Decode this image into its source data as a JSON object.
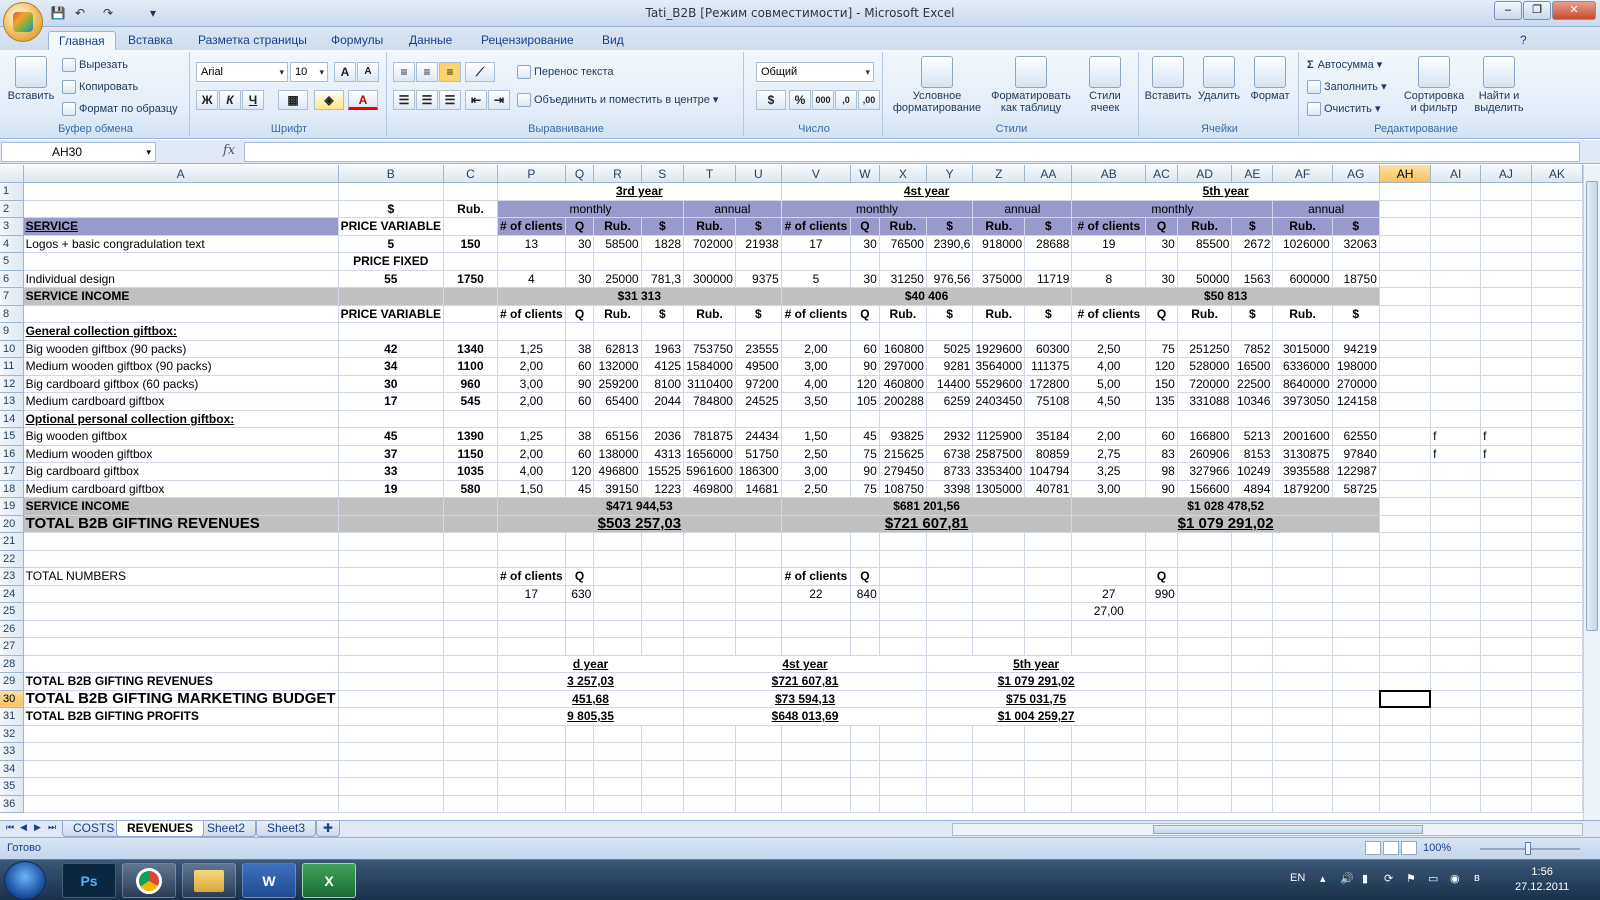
{
  "window": {
    "title": "Tati_B2B  [Режим совместимости] - Microsoft Excel"
  },
  "qat": {
    "save": "💾",
    "undo": "↶",
    "redo": "↷",
    "customize": "▾"
  },
  "ribbon_tabs": [
    "Главная",
    "Вставка",
    "Разметка страницы",
    "Формулы",
    "Данные",
    "Рецензирование",
    "Вид"
  ],
  "ribbon": {
    "clipboard": {
      "label": "Буфер обмена",
      "paste": "Вставить",
      "cut": "Вырезать",
      "copy": "Копировать",
      "format_painter": "Формат по образцу"
    },
    "font": {
      "label": "Шрифт",
      "name": "Arial",
      "size": "10",
      "grow": "A",
      "shrink": "A",
      "bold": "Ж",
      "italic": "К",
      "underline": "Ч",
      "color_letter": "A"
    },
    "alignment": {
      "label": "Выравнивание",
      "wrap": "Перенос текста",
      "merge": "Объединить и поместить в центре"
    },
    "number": {
      "label": "Число",
      "format": "Общий",
      "percent": "%",
      "thousands": "000",
      "inc_dec": ",0",
      "dec_dec": ",00"
    },
    "styles": {
      "label": "Стили",
      "conditional": "Условное форматирование",
      "as_table": "Форматировать как таблицу",
      "cell_styles": "Стили ячеек"
    },
    "cells": {
      "label": "Ячейки",
      "insert": "Вставить",
      "delete": "Удалить",
      "format": "Формат"
    },
    "editing": {
      "label": "Редактирование",
      "autosum": "Автосумма",
      "fill": "Заполнить",
      "clear": "Очистить",
      "sort": "Сортировка и фильтр",
      "find": "Найти и выделить"
    }
  },
  "formula_bar": {
    "name_box": "AH30",
    "fx": "fx",
    "value": ""
  },
  "columns": [
    "A",
    "B",
    "C",
    "P",
    "Q",
    "R",
    "S",
    "T",
    "U",
    "V",
    "W",
    "X",
    "Y",
    "Z",
    "AA",
    "AB",
    "AC",
    "AD",
    "AE",
    "AF",
    "AG",
    "AH",
    "AI",
    "AJ",
    "AK"
  ],
  "selected": {
    "row": "30",
    "col": "AH"
  },
  "rows": [
    {
      "n": "1",
      "cells": {}
    },
    {
      "n": "2",
      "cells": {}
    },
    {
      "n": "3",
      "cells": {
        "A": "SERVICE",
        "B": "PRICE VARIABLE",
        "P": "# of clients",
        "Q": "Q",
        "R": "Rub.",
        "S": "$",
        "T": "Rub.",
        "U": "$",
        "V": "# of clients",
        "W": "Q",
        "X": "Rub.",
        "Y": "$",
        "Z": "Rub.",
        "AA": "$",
        "AB": "# of clients",
        "AC": "Q",
        "AD": "Rub.",
        "AE": "$",
        "AF": "Rub.",
        "AG": "$"
      }
    },
    {
      "n": "4",
      "cells": {
        "A": "Logos + basic congradulation text",
        "B": "5",
        "C": "150",
        "P": "13",
        "Q": "30",
        "R": "58500",
        "S": "1828",
        "T": "702000",
        "U": "21938",
        "V": "17",
        "W": "30",
        "X": "76500",
        "Y": "2390,6",
        "Z": "918000",
        "AA": "28688",
        "AB": "19",
        "AC": "30",
        "AD": "85500",
        "AE": "2672",
        "AF": "1026000",
        "AG": "32063"
      }
    },
    {
      "n": "5",
      "cells": {
        "B": "PRICE FIXED"
      }
    },
    {
      "n": "6",
      "cells": {
        "A": "Individual design",
        "B": "55",
        "C": "1750",
        "P": "4",
        "Q": "30",
        "R": "25000",
        "S": "781,3",
        "T": "300000",
        "U": "9375",
        "V": "5",
        "W": "30",
        "X": "31250",
        "Y": "976,56",
        "Z": "375000",
        "AA": "11719",
        "AB": "8",
        "AC": "30",
        "AD": "50000",
        "AE": "1563",
        "AF": "600000",
        "AG": "18750"
      }
    },
    {
      "n": "7",
      "cells": {
        "A": "SERVICE INCOME"
      }
    },
    {
      "n": "8",
      "cells": {
        "B": "PRICE VARIABLE",
        "P": "# of clients",
        "Q": "Q",
        "R": "Rub.",
        "S": "$",
        "T": "Rub.",
        "U": "$",
        "V": "# of clients",
        "W": "Q",
        "X": "Rub.",
        "Y": "$",
        "Z": "Rub.",
        "AA": "$",
        "AB": "# of clients",
        "AC": "Q",
        "AD": "Rub.",
        "AE": "$",
        "AF": "Rub.",
        "AG": "$"
      }
    },
    {
      "n": "9",
      "cells": {
        "A": "General collection giftbox:"
      }
    },
    {
      "n": "10",
      "cells": {
        "A": "Big wooden giftbox (90 packs)",
        "B": "42",
        "C": "1340",
        "P": "1,25",
        "Q": "38",
        "R": "62813",
        "S": "1963",
        "T": "753750",
        "U": "23555",
        "V": "2,00",
        "W": "60",
        "X": "160800",
        "Y": "5025",
        "Z": "1929600",
        "AA": "60300",
        "AB": "2,50",
        "AC": "75",
        "AD": "251250",
        "AE": "7852",
        "AF": "3015000",
        "AG": "94219"
      }
    },
    {
      "n": "11",
      "cells": {
        "A": "Medium wooden giftbox (90 packs)",
        "B": "34",
        "C": "1100",
        "P": "2,00",
        "Q": "60",
        "R": "132000",
        "S": "4125",
        "T": "1584000",
        "U": "49500",
        "V": "3,00",
        "W": "90",
        "X": "297000",
        "Y": "9281",
        "Z": "3564000",
        "AA": "111375",
        "AB": "4,00",
        "AC": "120",
        "AD": "528000",
        "AE": "16500",
        "AF": "6336000",
        "AG": "198000"
      }
    },
    {
      "n": "12",
      "cells": {
        "A": "Big cardboard giftbox (60 packs)",
        "B": "30",
        "C": "960",
        "P": "3,00",
        "Q": "90",
        "R": "259200",
        "S": "8100",
        "T": "3110400",
        "U": "97200",
        "V": "4,00",
        "W": "120",
        "X": "460800",
        "Y": "14400",
        "Z": "5529600",
        "AA": "172800",
        "AB": "5,00",
        "AC": "150",
        "AD": "720000",
        "AE": "22500",
        "AF": "8640000",
        "AG": "270000"
      }
    },
    {
      "n": "13",
      "cells": {
        "A": "Medium cardboard giftbox",
        "B": "17",
        "C": "545",
        "P": "2,00",
        "Q": "60",
        "R": "65400",
        "S": "2044",
        "T": "784800",
        "U": "24525",
        "V": "3,50",
        "W": "105",
        "X": "200288",
        "Y": "6259",
        "Z": "2403450",
        "AA": "75108",
        "AB": "4,50",
        "AC": "135",
        "AD": "331088",
        "AE": "10346",
        "AF": "3973050",
        "AG": "124158"
      }
    },
    {
      "n": "14",
      "cells": {
        "A": "Optional personal collection giftbox:"
      }
    },
    {
      "n": "15",
      "cells": {
        "A": "Big wooden giftbox",
        "B": "45",
        "C": "1390",
        "P": "1,25",
        "Q": "38",
        "R": "65156",
        "S": "2036",
        "T": "781875",
        "U": "24434",
        "V": "1,50",
        "W": "45",
        "X": "93825",
        "Y": "2932",
        "Z": "1125900",
        "AA": "35184",
        "AB": "2,00",
        "AC": "60",
        "AD": "166800",
        "AE": "5213",
        "AF": "2001600",
        "AG": "62550",
        "AI": "f",
        "AJ": "f"
      }
    },
    {
      "n": "16",
      "cells": {
        "A": "Medium wooden giftbox",
        "B": "37",
        "C": "1150",
        "P": "2,00",
        "Q": "60",
        "R": "138000",
        "S": "4313",
        "T": "1656000",
        "U": "51750",
        "V": "2,50",
        "W": "75",
        "X": "215625",
        "Y": "6738",
        "Z": "2587500",
        "AA": "80859",
        "AB": "2,75",
        "AC": "83",
        "AD": "260906",
        "AE": "8153",
        "AF": "3130875",
        "AG": "97840",
        "AI": "f",
        "AJ": "f"
      }
    },
    {
      "n": "17",
      "cells": {
        "A": "Big cardboard giftbox",
        "B": "33",
        "C": "1035",
        "P": "4,00",
        "Q": "120",
        "R": "496800",
        "S": "15525",
        "T": "5961600",
        "U": "186300",
        "V": "3,00",
        "W": "90",
        "X": "279450",
        "Y": "8733",
        "Z": "3353400",
        "AA": "104794",
        "AB": "3,25",
        "AC": "98",
        "AD": "327966",
        "AE": "10249",
        "AF": "3935588",
        "AG": "122987"
      }
    },
    {
      "n": "18",
      "cells": {
        "A": "Medium cardboard giftbox",
        "B": "19",
        "C": "580",
        "P": "1,50",
        "Q": "45",
        "R": "39150",
        "S": "1223",
        "T": "469800",
        "U": "14681",
        "V": "2,50",
        "W": "75",
        "X": "108750",
        "Y": "3398",
        "Z": "1305000",
        "AA": "40781",
        "AB": "3,00",
        "AC": "90",
        "AD": "156600",
        "AE": "4894",
        "AF": "1879200",
        "AG": "58725"
      }
    },
    {
      "n": "19",
      "cells": {
        "A": "SERVICE INCOME"
      }
    },
    {
      "n": "20",
      "cells": {
        "A": "TOTAL B2B GIFTING REVENUES"
      }
    },
    {
      "n": "21",
      "cells": {}
    },
    {
      "n": "22",
      "cells": {}
    },
    {
      "n": "23",
      "cells": {
        "A": "TOTAL NUMBERS",
        "P": "# of clients",
        "Q": "Q",
        "V": "# of clients",
        "W": "Q",
        "AC": "Q"
      }
    },
    {
      "n": "24",
      "cells": {
        "P": "17",
        "Q": "630",
        "V": "22",
        "W": "840",
        "AB": "27",
        "AC": "990"
      }
    },
    {
      "n": "25",
      "cells": {
        "AB": "27,00"
      }
    },
    {
      "n": "26",
      "cells": {}
    },
    {
      "n": "27",
      "cells": {}
    },
    {
      "n": "28",
      "cells": {}
    },
    {
      "n": "29",
      "cells": {
        "A": "TOTAL B2B GIFTING REVENUES"
      }
    },
    {
      "n": "30",
      "cells": {
        "A": "TOTAL B2B GIFTING MARKETING BUDGET"
      }
    },
    {
      "n": "31",
      "cells": {
        "A": "TOTAL B2B GIFTING PROFITS"
      }
    },
    {
      "n": "32",
      "cells": {}
    },
    {
      "n": "33",
      "cells": {}
    },
    {
      "n": "34",
      "cells": {}
    },
    {
      "n": "35",
      "cells": {}
    },
    {
      "n": "36",
      "cells": {}
    }
  ],
  "merged": {
    "r1_y3": "3rd year",
    "r1_y4": "4st year",
    "r1_y5": "5th year",
    "r2_usd": "$",
    "r2_rub": "Rub.",
    "monthly": "monthly",
    "annual": "annual",
    "r7_y3": "$31 313",
    "r7_y4": "$40 406",
    "r7_y5": "$50 813",
    "r19_y3": "$471 944,53",
    "r19_y4": "$681 201,56",
    "r19_y5": "$1 028 478,52",
    "r20_y3": "$503 257,03",
    "r20_y4": "$721 607,81",
    "r20_y5": "$1 079 291,02",
    "r28_y3": "d year",
    "r28_y4": "4st year",
    "r28_y5": "5th year",
    "r29_y3": "3 257,03",
    "r29_y4": "$721 607,81",
    "r29_y5": "$1 079 291,02",
    "r30_y3": "451,68",
    "r30_y4": "$73 594,13",
    "r30_y5": "$75 031,75",
    "r31_y3": "9 805,35",
    "r31_y4": "$648 013,69",
    "r31_y5": "$1 004 259,27"
  },
  "sheets": [
    "COSTS",
    "REVENUES",
    "Sheet2",
    "Sheet3"
  ],
  "active_sheet": "REVENUES",
  "status": {
    "text": "Готово",
    "zoom": "100%"
  },
  "taskbar": {
    "apps": [
      "Ps",
      "Chrome",
      "Explorer",
      "Word",
      "Excel"
    ],
    "lang": "EN",
    "time": "1:56",
    "date": "27.12.2011"
  }
}
